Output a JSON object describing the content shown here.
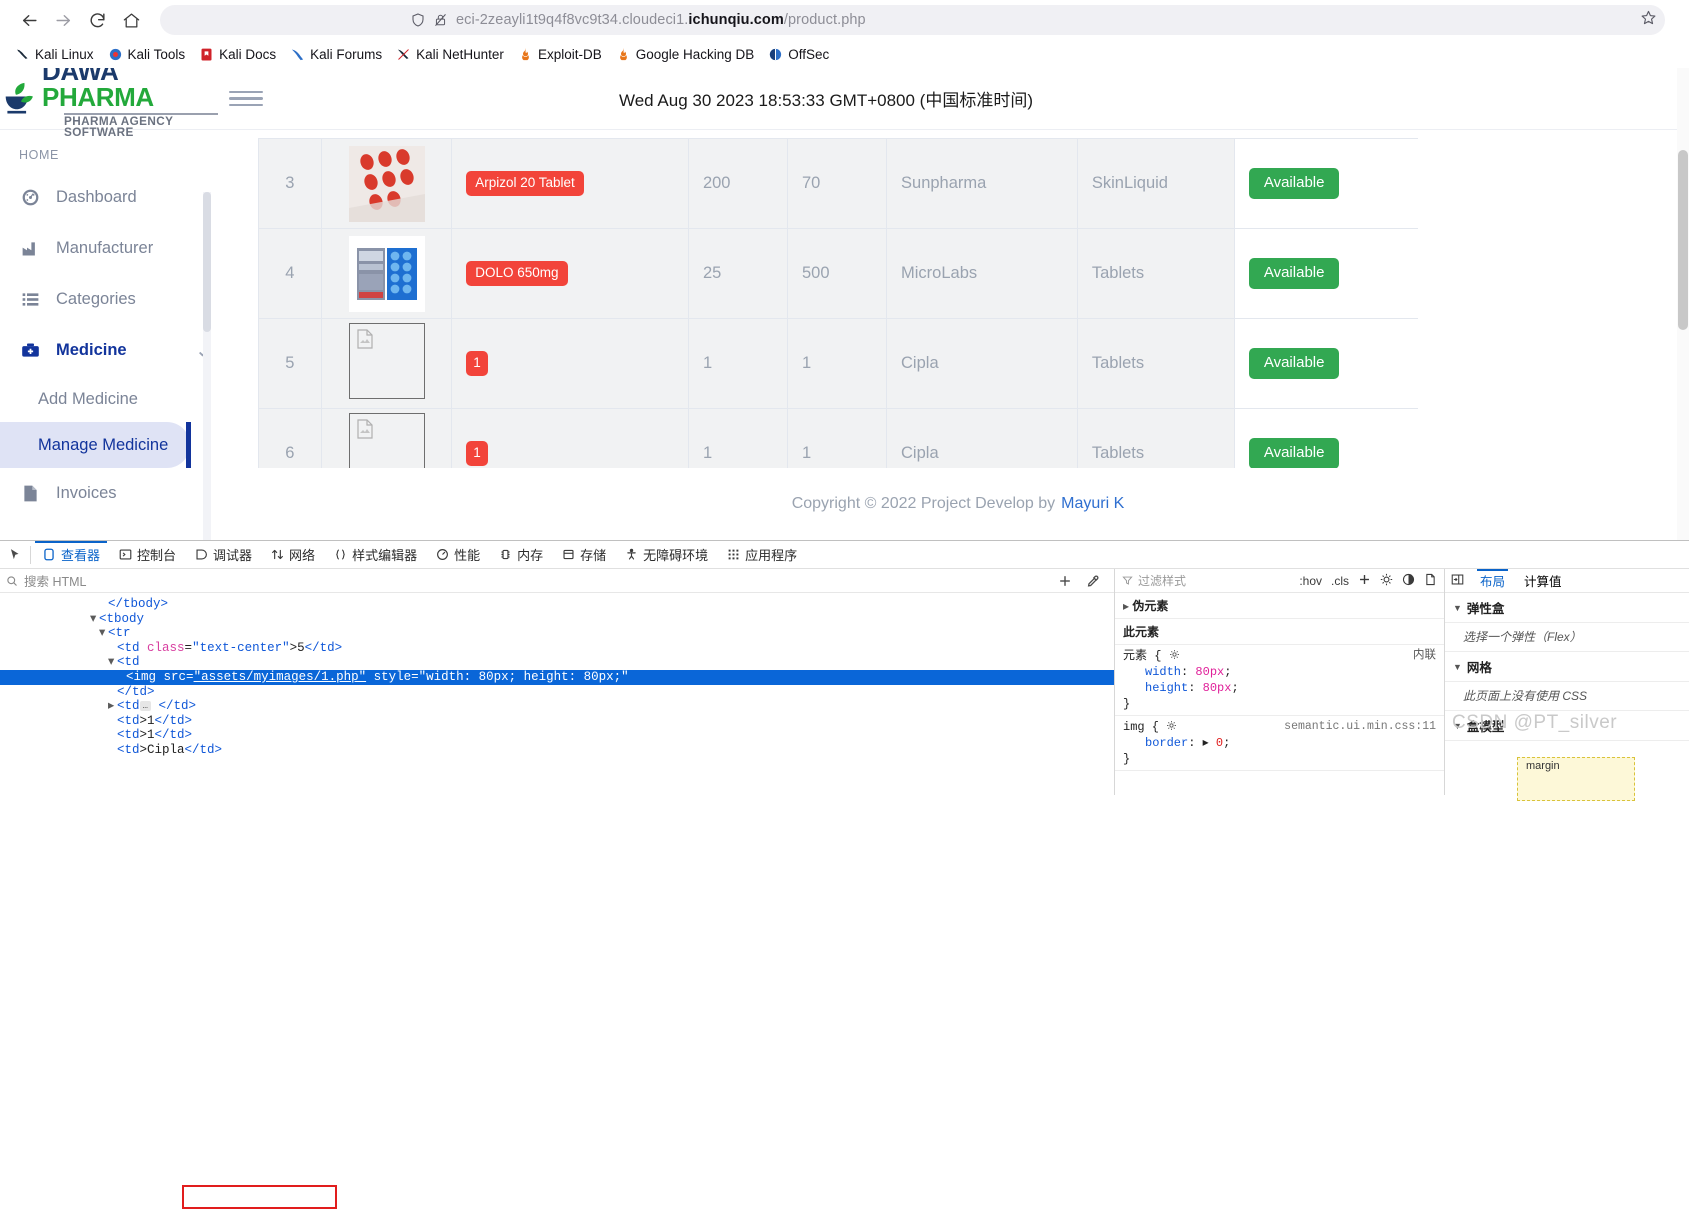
{
  "browser": {
    "nav": {
      "back": "back-arrow",
      "forward": "forward-arrow",
      "reload": "reload",
      "home": "home"
    },
    "url": {
      "prefix": "eci-2zeayli1t9q4f8vc9t34.cloudeci1.",
      "domain": "ichunqiu.com",
      "path": "/product.php"
    },
    "bookmarks": [
      {
        "label": "Kali Linux"
      },
      {
        "label": "Kali Tools"
      },
      {
        "label": "Kali Docs"
      },
      {
        "label": "Kali Forums"
      },
      {
        "label": "Kali NetHunter"
      },
      {
        "label": "Exploit-DB"
      },
      {
        "label": "Google Hacking DB"
      },
      {
        "label": "OffSec"
      }
    ]
  },
  "app": {
    "brand": {
      "word1": "DAWA",
      "word2": "PHARMA",
      "tagline": "PHARMA AGENCY SOFTWARE"
    },
    "topbar": {
      "date": "Wed Aug 30 2023 18:53:33 GMT+0800 (中国标准时间)"
    },
    "sidebar": {
      "section_label": "HOME",
      "items": [
        {
          "label": "Dashboard",
          "icon": "dashboard-icon",
          "arrow": ""
        },
        {
          "label": "Manufacturer",
          "icon": "factory-icon",
          "arrow": "›"
        },
        {
          "label": "Categories",
          "icon": "list-icon",
          "arrow": "›"
        },
        {
          "label": "Medicine",
          "icon": "medkit-icon",
          "arrow": "⌄"
        }
      ],
      "sub_items": [
        {
          "label": "Add Medicine",
          "active": false
        },
        {
          "label": "Manage Medicine",
          "active": true
        }
      ],
      "after": [
        {
          "label": "Invoices",
          "icon": "file-icon",
          "arrow": "›"
        }
      ]
    },
    "table": {
      "rows": [
        {
          "id": "3",
          "image": "pills-photo",
          "name": "Arpizol 20 Tablet",
          "qty": "200",
          "price": "70",
          "manufacturer": "Sunpharma",
          "category": "SkinLiquid",
          "status": "Available"
        },
        {
          "id": "4",
          "image": "blister-photo",
          "name": "DOLO 650mg",
          "qty": "25",
          "price": "500",
          "manufacturer": "MicroLabs",
          "category": "Tablets",
          "status": "Available"
        },
        {
          "id": "5",
          "image": "broken-image",
          "name": "1",
          "qty": "1",
          "price": "1",
          "manufacturer": "Cipla",
          "category": "Tablets",
          "status": "Available"
        },
        {
          "id": "6",
          "image": "broken-image",
          "name": "1",
          "qty": "1",
          "price": "1",
          "manufacturer": "Cipla",
          "category": "Tablets",
          "status": "Available"
        }
      ]
    },
    "footer": {
      "text": "Copyright © 2022 Project Develop by",
      "author": "Mayuri K"
    }
  },
  "devtools": {
    "tabs": [
      {
        "label": "查看器",
        "icon": "inspector-icon",
        "selected": true
      },
      {
        "label": "控制台",
        "icon": "console-icon",
        "selected": false
      },
      {
        "label": "调试器",
        "icon": "debugger-icon",
        "selected": false
      },
      {
        "label": "网络",
        "icon": "network-icon",
        "selected": false
      },
      {
        "label": "样式编辑器",
        "icon": "style-editor-icon",
        "selected": false
      },
      {
        "label": "性能",
        "icon": "performance-icon",
        "selected": false
      },
      {
        "label": "内存",
        "icon": "memory-icon",
        "selected": false
      },
      {
        "label": "存储",
        "icon": "storage-icon",
        "selected": false
      },
      {
        "label": "无障碍环境",
        "icon": "accessibility-icon",
        "selected": false
      },
      {
        "label": "应用程序",
        "icon": "application-icon",
        "selected": false
      }
    ],
    "search_placeholder": "搜索 HTML",
    "dom_lines": [
      {
        "indent": 6,
        "html": "</tbody>"
      },
      {
        "indent": 5,
        "html": "<tbody>"
      },
      {
        "indent": 6,
        "html": "<tr"
      },
      {
        "indent": 7,
        "html": "<td class=\"text-center\">5</td>"
      },
      {
        "indent": 7,
        "html": "<td"
      },
      {
        "indent": 8,
        "html": "<img src=\"assets/myimages/1.php\" style=\"width: 80px; height: 80px;\"",
        "selected": true
      },
      {
        "indent": 7,
        "html": "</td>"
      },
      {
        "indent": 6,
        "html": "<td …> </td>"
      },
      {
        "indent": 6,
        "html": "<td>1</td>"
      },
      {
        "indent": 6,
        "html": "<td>1</td>"
      },
      {
        "indent": 6,
        "html": "<td>Cipla</td>"
      }
    ],
    "rules": {
      "filter_placeholder": "过滤样式",
      "buttons": [
        ":hov",
        ".cls"
      ],
      "pseudo_label": "伪元素",
      "this_element_label": "此元素",
      "element_rule": {
        "selector": "元素 {",
        "origin": "内联",
        "props": [
          {
            "name": "width",
            "value": "80px"
          },
          {
            "name": "height",
            "value": "80px"
          }
        ]
      },
      "img_rule": {
        "selector": "img {",
        "source": "semantic.ui.min.css:11",
        "props": [
          {
            "name": "border",
            "value": "0"
          }
        ]
      }
    },
    "layout": {
      "tabs": [
        {
          "label": "布局",
          "selected": true
        },
        {
          "label": "计算值",
          "selected": false
        }
      ],
      "sections": [
        {
          "title": "弹性盒",
          "note": "选择一个弹性（Flex）"
        },
        {
          "title": "网格",
          "note": "此页面上没有使用 CSS"
        },
        {
          "title": "盒模型",
          "note": ""
        }
      ],
      "box_label": "margin"
    }
  },
  "watermark": "CSDN @PT_silver"
}
